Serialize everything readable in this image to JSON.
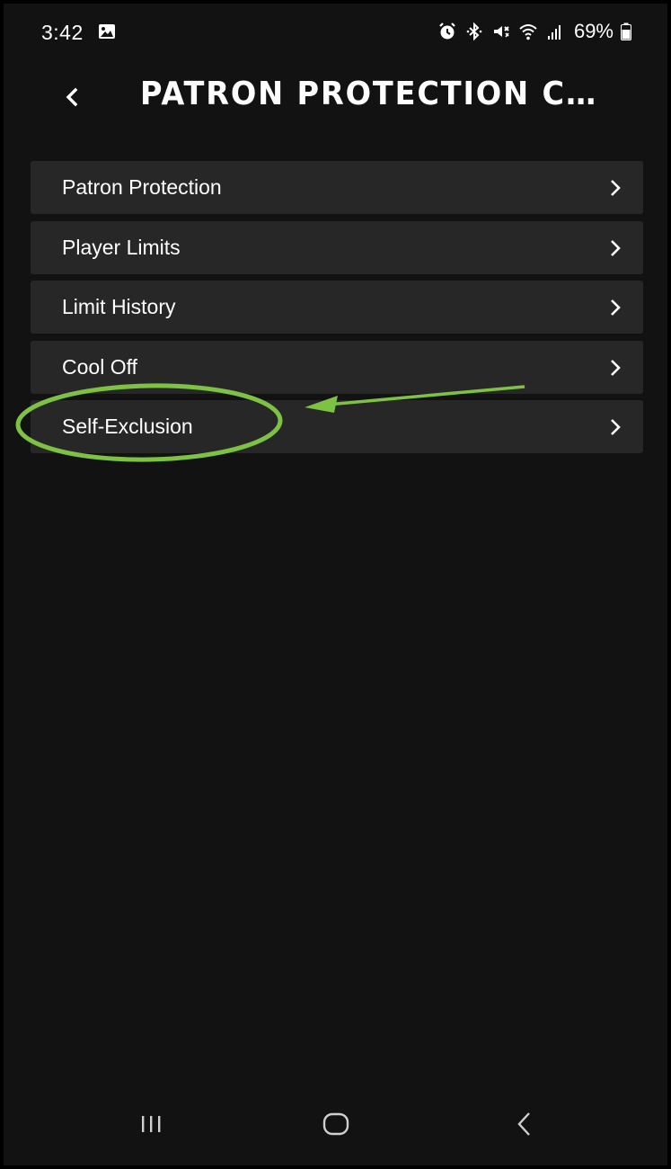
{
  "status_bar": {
    "time": "3:42",
    "battery": "69%",
    "icons": [
      "gallery-icon",
      "alarm-icon",
      "bluetooth-icon",
      "mute-icon",
      "wifi-icon",
      "signal-icon",
      "battery-icon"
    ]
  },
  "header": {
    "title": "PATRON PROTECTION CENT...",
    "back_icon": "chevron-left-icon"
  },
  "menu": {
    "items": [
      {
        "label": "Patron Protection"
      },
      {
        "label": "Player Limits"
      },
      {
        "label": "Limit History"
      },
      {
        "label": "Cool Off"
      },
      {
        "label": "Self-Exclusion"
      }
    ]
  },
  "annotation": {
    "color": "#7DC242",
    "target": "Self-Exclusion"
  },
  "nav_bar": {
    "icons": [
      "recent-apps-icon",
      "home-icon",
      "back-icon"
    ]
  },
  "colors": {
    "background": "#121212",
    "menu_item": "#272727",
    "text": "#FFFFFF",
    "annotation": "#7DC242"
  }
}
